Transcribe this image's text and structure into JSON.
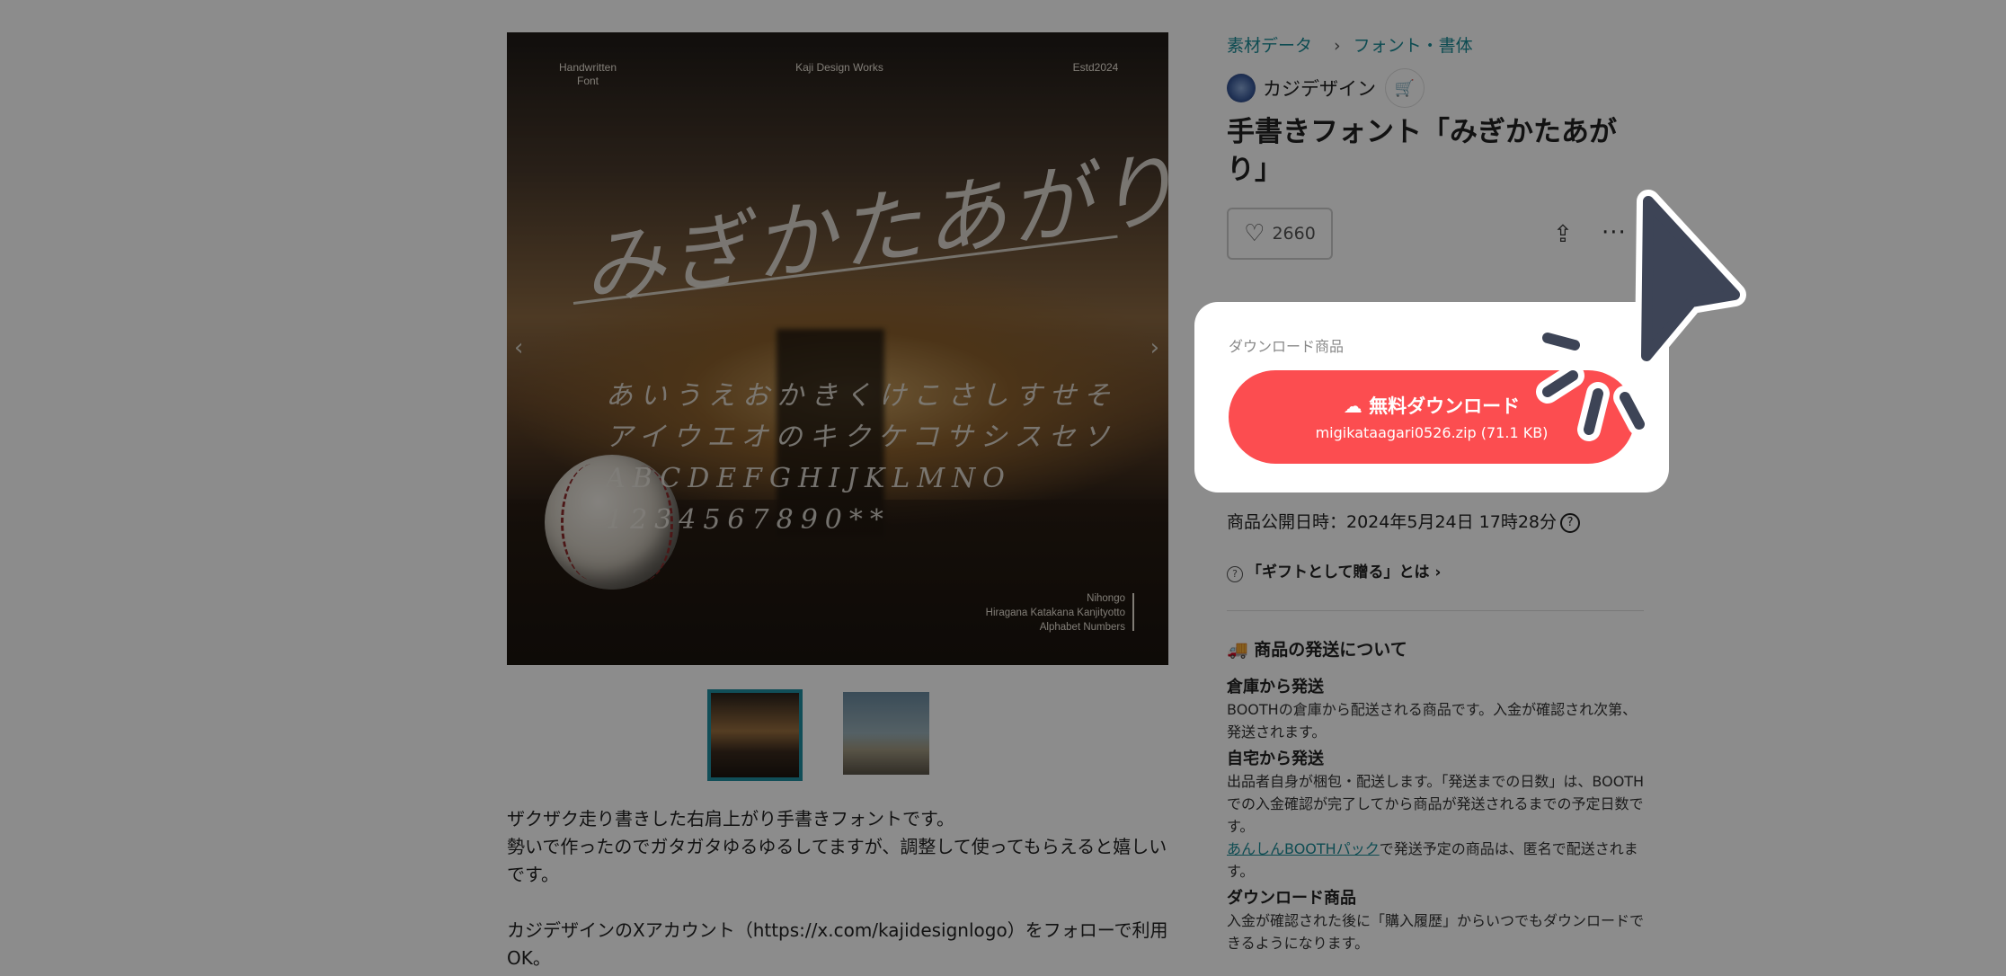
{
  "gallery": {
    "header_left": "Handwritten\nFont",
    "header_center": "Kaji Design Works",
    "header_right": "Estd2024",
    "title_script": "みぎかたあがり",
    "glyph_rows": [
      "あいうえおかきくけこさしすせそ",
      "アイウエオのキクケコサシスセソ",
      "ABCDEFGHIJKLMNO",
      "1234567890**"
    ],
    "sub_lines": [
      "Nihongo",
      "Hiragana Katakana Kanjityotto",
      "Alphabet Numbers"
    ],
    "prev_arrow": "‹",
    "next_arrow": "›"
  },
  "description": {
    "p1": "ザクザク走り書きした右肩上がり手書きフォントです。",
    "p2": "勢いで作ったのでガタガタゆるゆるしてますが、調整して使ってもらえると嬉しいです。",
    "p3": "カジデザインのXアカウント（https://x.com/kajidesignlogo）をフォローで利用OK。"
  },
  "breadcrumb": {
    "item1": "素材データ",
    "separator": "›",
    "item2": "フォント・書体"
  },
  "shop": {
    "name": "カジデザイン",
    "cart_icon": "🛒"
  },
  "product": {
    "title": "手書きフォント「みぎかたあがり」",
    "likes": "2660",
    "heart_icon": "♡",
    "share_icon": "⇪",
    "more_icon": "···"
  },
  "download": {
    "label": "ダウンロード商品",
    "button_label": "無料ダウンロード",
    "file": "migikataagari0526.zip (71.1 KB)",
    "icon": "☁"
  },
  "published": {
    "text": "商品公開日時：2024年5月24日 17時28分",
    "help": "?"
  },
  "gift": {
    "icon": "?",
    "text": "「ギフトとして贈る」とは ›"
  },
  "shipping": {
    "title": "商品の発送について",
    "truck_icon": "🚚",
    "warehouse_title": "倉庫から発送",
    "warehouse_body": "BOOTHの倉庫から配送される商品です。入金が確認され次第、発送されます。",
    "home_title": "自宅から発送",
    "home_body": "出品者自身が梱包・配送します。「発送までの日数」は、BOOTHでの入金確認が完了してから商品が発送されるまでの予定日数です。",
    "anshin_link": "あんしんBOOTHパック",
    "anshin_body": "で発送予定の商品は、匿名で配送されます。",
    "dl_title": "ダウンロード商品",
    "dl_body": "入金が確認された後に「購入履歴」からいつでもダウンロードできるようになります。"
  },
  "colors": {
    "accent": "#1a8a96",
    "download": "#fc4d50",
    "cursor": "#3d4456"
  }
}
